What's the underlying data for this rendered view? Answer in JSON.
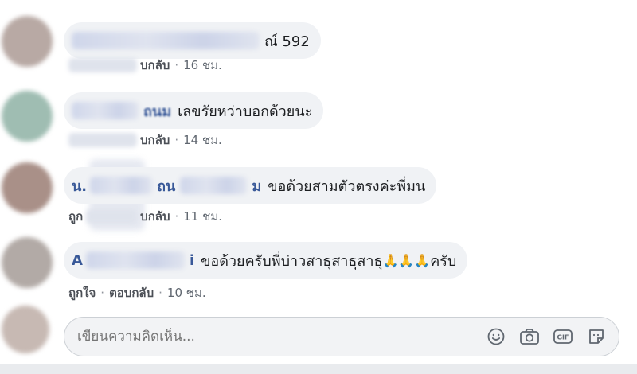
{
  "comments": [
    {
      "text": "ณ์ 592",
      "actions": {
        "reply": "บกลับ",
        "time": "16 ชม."
      }
    },
    {
      "name_tail": "ถนม",
      "text": "เลขรัยหว่าบอกด้วยนะ",
      "actions": {
        "reply": "บกลับ",
        "time": "14 ชม."
      }
    },
    {
      "name_head": "น.",
      "name_mid": "ถน",
      "name_tail": "ม",
      "text": "ขอด้วยสามตัวตรงค่ะพี่มน",
      "actions": {
        "like_prefix": "ถูก",
        "reply": "บกลับ",
        "time": "11 ชม."
      }
    },
    {
      "name_head": "A",
      "name_tail": "i",
      "text": "ขอด้วยครับพี่บ่าวสาธุสาธุสาธุ",
      "emoji": "🙏🙏🙏",
      "text_tail": "ครับ",
      "actions": {
        "like": "ถูกใจ",
        "reply": "ตอบกลับ",
        "time": "10 ชม."
      }
    }
  ],
  "composer": {
    "placeholder": "เขียนความคิดเห็น...",
    "icons": [
      "emoji-icon",
      "camera-icon",
      "gif-icon",
      "sticker-icon"
    ]
  },
  "colors": {
    "name": "#385898",
    "bubble": "#f0f2f5",
    "meta": "#606770"
  }
}
